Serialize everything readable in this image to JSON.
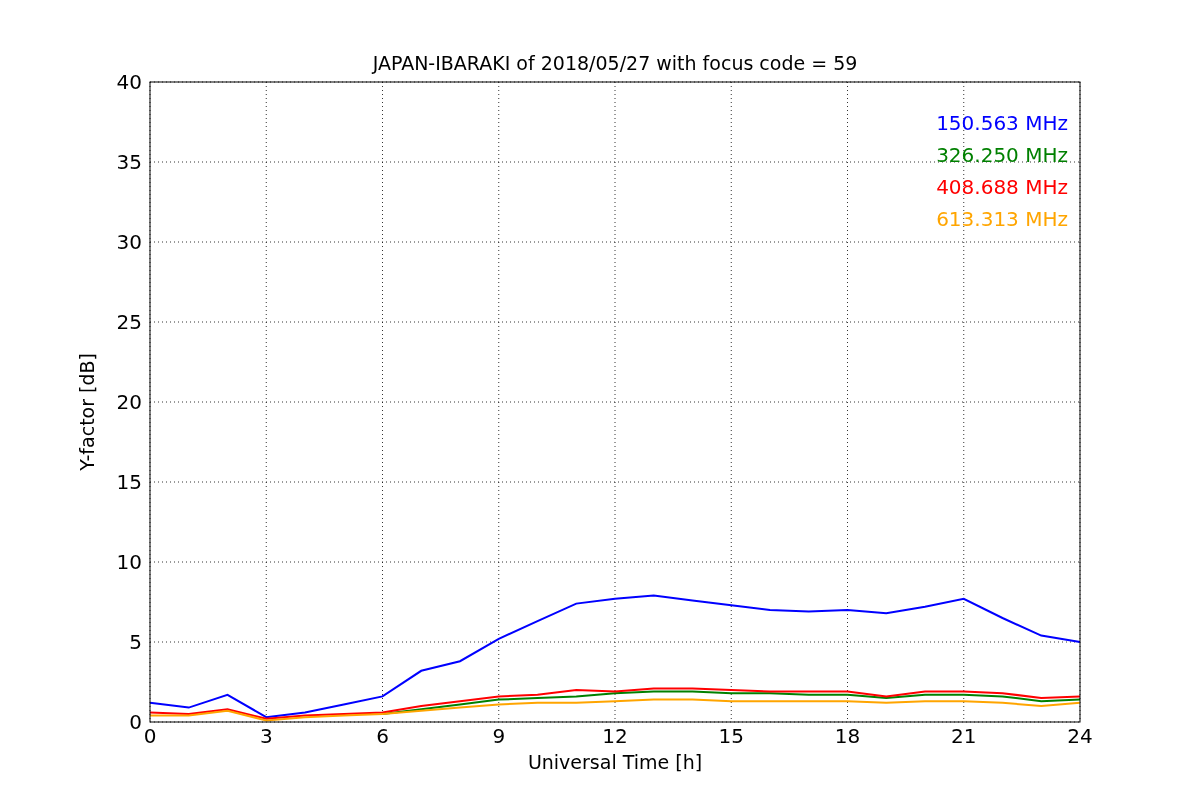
{
  "chart_data": {
    "type": "line",
    "title": "JAPAN-IBARAKI of 2018/05/27 with focus code = 59",
    "xlabel": "Universal Time [h]",
    "ylabel": "Y-factor [dB]",
    "x": [
      0,
      1,
      2,
      3,
      4,
      5,
      6,
      7,
      8,
      9,
      10,
      11,
      12,
      13,
      14,
      15,
      16,
      17,
      18,
      19,
      20,
      21,
      22,
      23,
      24
    ],
    "series": [
      {
        "name": "150.563 MHz",
        "color": "#0000ff",
        "values": [
          1.2,
          0.9,
          1.7,
          0.3,
          0.6,
          1.1,
          1.6,
          3.2,
          3.8,
          5.2,
          6.3,
          7.4,
          7.7,
          7.9,
          7.6,
          7.3,
          7.0,
          6.9,
          7.0,
          6.8,
          7.2,
          7.7,
          6.5,
          5.4,
          5.0
        ]
      },
      {
        "name": "326.250 MHz",
        "color": "#008000",
        "values": [
          null,
          null,
          null,
          null,
          null,
          null,
          0.5,
          0.8,
          1.1,
          1.4,
          1.5,
          1.6,
          1.8,
          1.9,
          1.9,
          1.8,
          1.8,
          1.7,
          1.7,
          1.5,
          1.7,
          1.7,
          1.6,
          1.3,
          1.4
        ]
      },
      {
        "name": "408.688 MHz",
        "color": "#ff0000",
        "values": [
          0.6,
          0.5,
          0.8,
          0.2,
          0.4,
          0.5,
          0.6,
          1.0,
          1.3,
          1.6,
          1.7,
          2.0,
          1.9,
          2.1,
          2.1,
          2.0,
          1.9,
          1.9,
          1.9,
          1.6,
          1.9,
          1.9,
          1.8,
          1.5,
          1.6
        ]
      },
      {
        "name": "613.313 MHz",
        "color": "#ffa500",
        "values": [
          0.4,
          0.4,
          0.7,
          0.1,
          0.3,
          0.4,
          0.5,
          0.7,
          0.9,
          1.1,
          1.2,
          1.2,
          1.3,
          1.4,
          1.4,
          1.3,
          1.3,
          1.3,
          1.3,
          1.2,
          1.3,
          1.3,
          1.2,
          1.0,
          1.2
        ]
      }
    ],
    "grid": true,
    "xlim": [
      0,
      24
    ],
    "ylim": [
      0,
      40
    ],
    "xticks": [
      0,
      3,
      6,
      9,
      12,
      15,
      18,
      21,
      24
    ],
    "yticks": [
      0,
      5,
      10,
      15,
      20,
      25,
      30,
      35,
      40
    ]
  }
}
